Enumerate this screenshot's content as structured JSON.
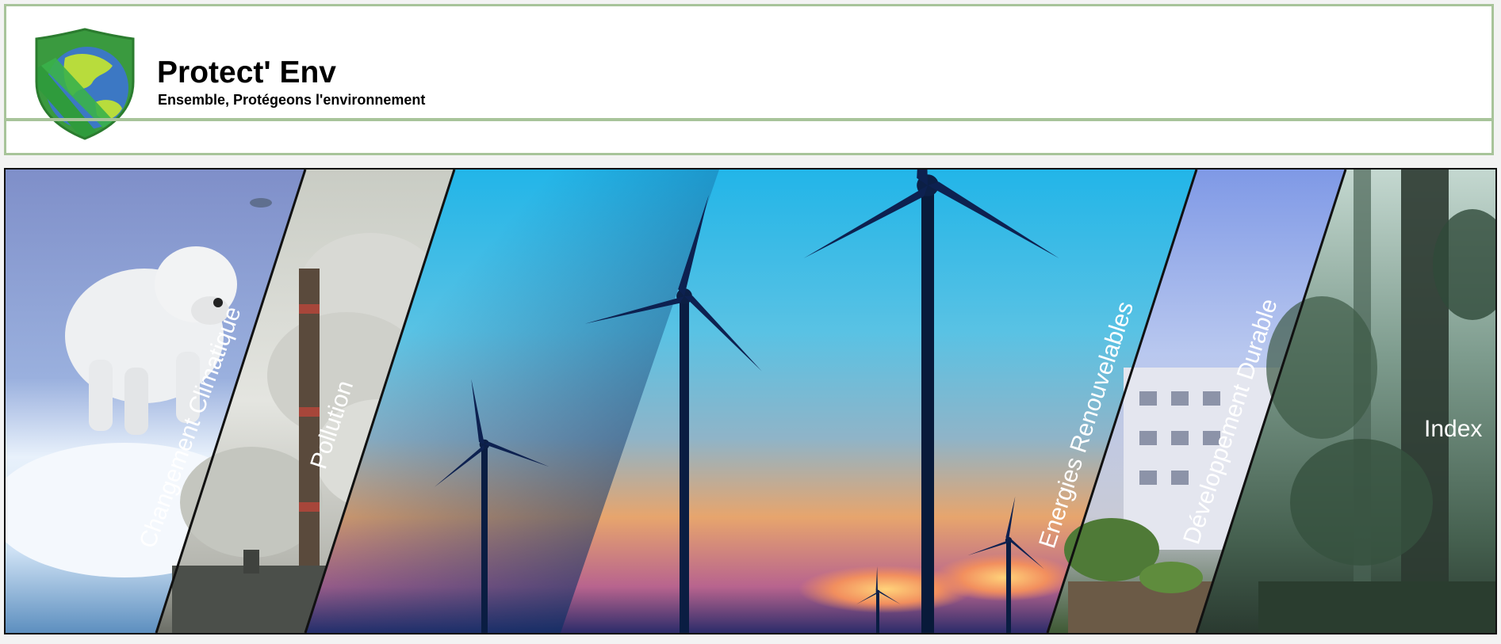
{
  "header": {
    "title": "Protect' Env",
    "tagline": "Ensemble, Protégeons l'environnement"
  },
  "colors": {
    "header_border": "#a8c49a",
    "logo_shield": "#3a9a3f",
    "logo_earth_land": "#b8dc3c",
    "logo_earth_water": "#3c78c4"
  },
  "nav": {
    "panels": [
      {
        "label": "Changement Climatique",
        "icon": "polar-bear-on-ice"
      },
      {
        "label": "Pollution",
        "icon": "factory-chimney-smoke"
      },
      {
        "label": "Energies Renouvelables",
        "icon": "wind-turbines-sunset"
      },
      {
        "label": "Développement Durable",
        "icon": "green-building"
      },
      {
        "label": "Index",
        "icon": "forest-trees"
      }
    ]
  }
}
